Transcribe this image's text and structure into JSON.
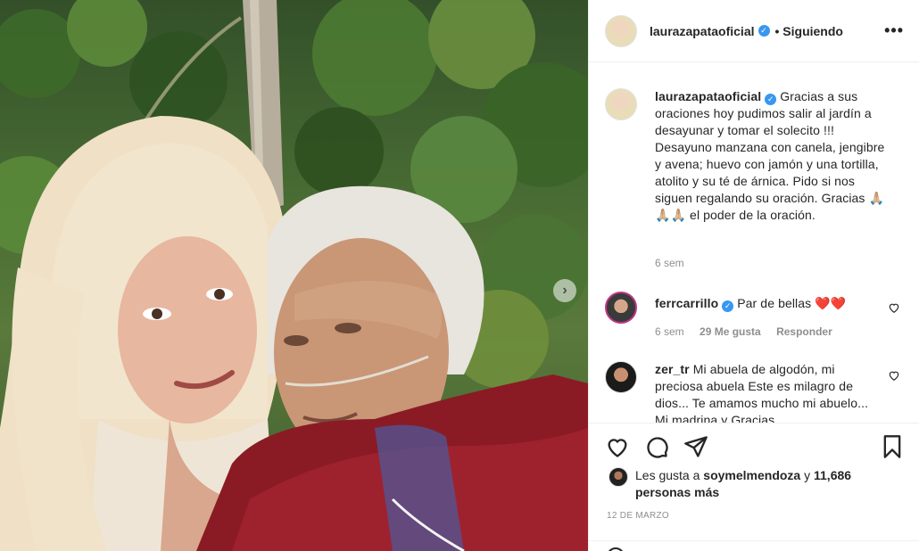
{
  "post": {
    "author": "laurazapataoficial",
    "follow_status": "• Siguiendo",
    "more_label": "•••",
    "next_glyph": "›"
  },
  "caption": {
    "username": "laurazapataoficial",
    "text": "Gracias a sus oraciones hoy pudimos salir al jardín a desayunar y tomar el solecito !!! Desayuno manzana con canela, jengibre y avena; huevo con jamón y una tortilla, atolito y su té de árnica. Pido si nos siguen regalando su oración. Gracias 🙏🏼🙏🏼🙏🏼 el poder de la oración.",
    "time": "6 sem"
  },
  "comments": [
    {
      "username": "ferrcarrillo",
      "verified": true,
      "text": "Par de bellas",
      "emoji": "❤️❤️",
      "time": "6 sem",
      "likes": "29 Me gusta",
      "reply": "Responder"
    },
    {
      "username": "zer_tr",
      "verified": false,
      "text": "Mi abuela de algodón, mi preciosa abuela Este es milagro de dios... Te amamos mucho mi abuelo... Mi madrina y Gracias"
    }
  ],
  "likes": {
    "prefix": "Les gusta a",
    "user": "soymelmendoza",
    "conj": "y",
    "count": "11,686 personas más"
  },
  "date": "12 DE MARZO",
  "colors": {
    "verified": "#3897f0",
    "heart": "#ed4956",
    "muted": "#8e8e8e",
    "text": "#262626"
  },
  "icons": [
    "heart-icon",
    "comment-icon",
    "share-icon",
    "bookmark-icon",
    "verified-icon",
    "more-icon",
    "chevron-right-icon"
  ]
}
